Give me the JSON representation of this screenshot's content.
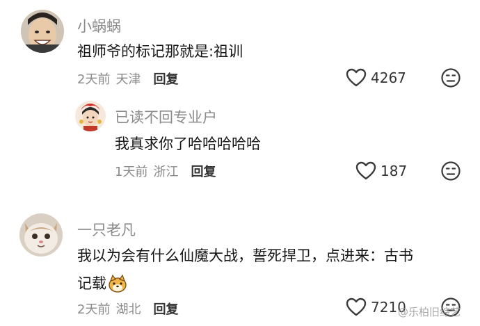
{
  "comments": [
    {
      "username": "小蜗蜗",
      "text_lines": [
        "祖师爷的标记那就是:祖训"
      ],
      "time": "2天前",
      "location": "天津",
      "reply_label": "回复",
      "likes": "4267",
      "replies": [
        {
          "username": "已读不回专业户",
          "text_lines": [
            "我真求你了哈哈哈哈哈"
          ],
          "time": "1天前",
          "location": "浙江",
          "reply_label": "回复",
          "likes": "187"
        }
      ]
    },
    {
      "username": "一只老凡",
      "text_lines": [
        "我以为会有什么仙魔大战，誓死捍卫，点进来：古书",
        "记载"
      ],
      "time": "2天前",
      "location": "湖北",
      "reply_label": "回复",
      "likes": "7210"
    }
  ],
  "watermark": "@乐柏旧综艺",
  "icons": {
    "like": "heart-outline-icon",
    "dislike": "neutral-face-icon",
    "emoji": "shiba-dog-emoji-icon"
  },
  "colors": {
    "meta_text": "#8a8a8a",
    "body_text": "#161616",
    "icon_stroke": "#3a3a3a"
  }
}
